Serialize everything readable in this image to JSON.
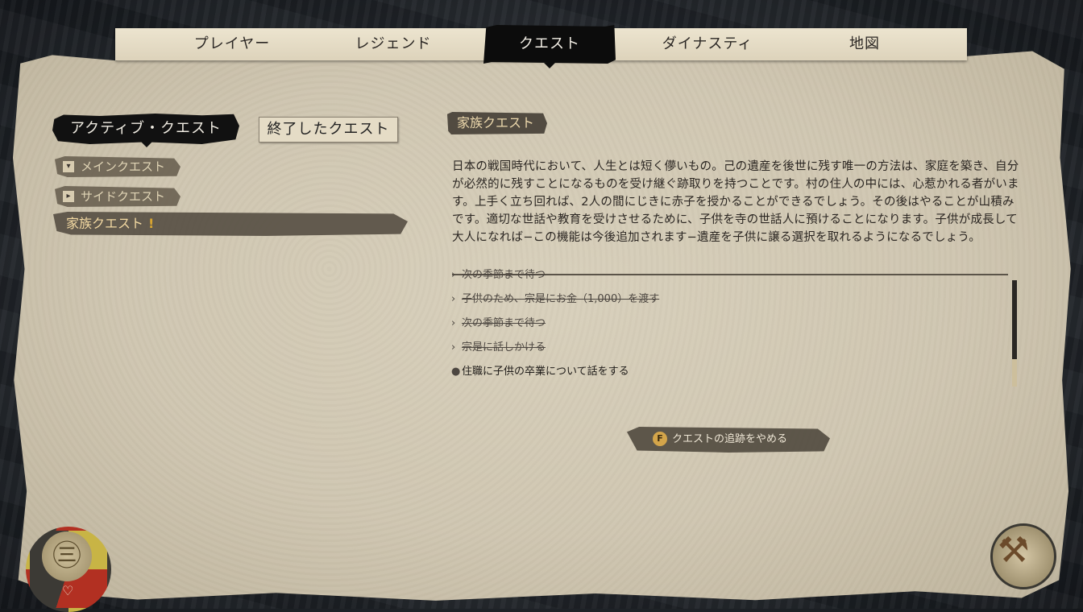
{
  "tabs": [
    {
      "label": "プレイヤー",
      "active": false
    },
    {
      "label": "レジェンド",
      "active": false
    },
    {
      "label": "クエスト",
      "active": true
    },
    {
      "label": "ダイナスティ",
      "active": false
    },
    {
      "label": "地図",
      "active": false
    }
  ],
  "left_panel": {
    "active_subtab": "アクティブ・クエスト",
    "inactive_subtab": "終了したクエスト",
    "categories": [
      {
        "label": "メインクエスト",
        "icon": "chevron-down-icon"
      },
      {
        "label": "サイドクエスト",
        "icon": "chevron-right-icon"
      }
    ],
    "selected_quest": {
      "label": "家族クエスト",
      "icon": "exclamation-icon"
    }
  },
  "quest": {
    "title": "家族クエスト",
    "description": "日本の戦国時代において、人生とは短く儚いもの。己の遺産を後世に残す唯一の方法は、家庭を築き、自分が必然的に残すことになるものを受け継ぐ跡取りを持つことです。村の住人の中には、心惹かれる者がいます。上手く立ち回れば、2人の間にじきに赤子を授かることができるでしょう。その後はやることが山積みです。適切な世話や教育を受けさせるために、子供を寺の世話人に預けることになります。子供が成長して大人になれば−この機能は今後追加されます−遺産を子供に譲る選択を取れるようになるでしょう。",
    "objectives": [
      {
        "text": "次の季節まで待つ",
        "status": "done"
      },
      {
        "text": "子供のため、宗是にお金（1,000）を渡す",
        "status": "done"
      },
      {
        "text": "次の季節まで待つ",
        "status": "done"
      },
      {
        "text": "宗是に話しかける",
        "status": "done"
      },
      {
        "text": "住職に子供の卒業について話をする",
        "status": "current"
      }
    ],
    "stop_tracking": {
      "key": "F",
      "label": "クエストの追跡をやめる"
    }
  },
  "hud": {
    "left_emblem": "clan-emblem-icon",
    "right_tool": "axe-icon",
    "colors": {
      "stamina": "#c8b445",
      "health": "#b23022"
    }
  }
}
